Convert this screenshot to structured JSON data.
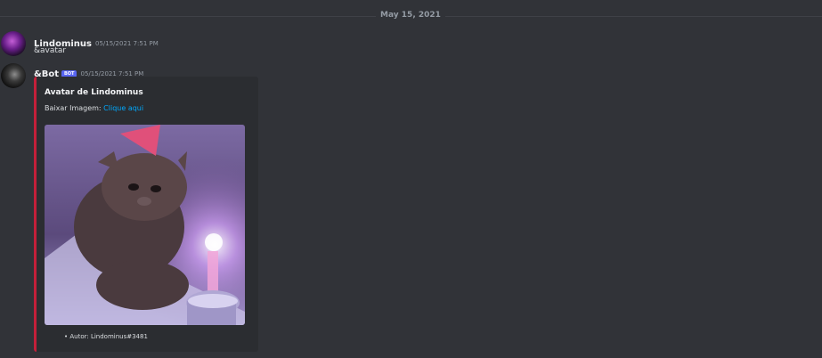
{
  "date_divider": "May 15, 2021",
  "messages": [
    {
      "username": "Lindominus",
      "timestamp": "05/15/2021 7:51 PM",
      "text": "&avatar"
    },
    {
      "username": "&Bot",
      "bot_tag": "BOT",
      "timestamp": "05/15/2021 7:51 PM",
      "embed": {
        "accent_color": "#c4203a",
        "title": "Avatar de Lindominus",
        "description_prefix": "Baixar Imagem:",
        "link_text": "Clique aqui",
        "footer": "• Autor: Lindominus#3481"
      }
    }
  ],
  "colors": {
    "background": "#313338",
    "embed_background": "#2b2d31",
    "link": "#00a8fc",
    "bot_tag": "#5865f2"
  }
}
